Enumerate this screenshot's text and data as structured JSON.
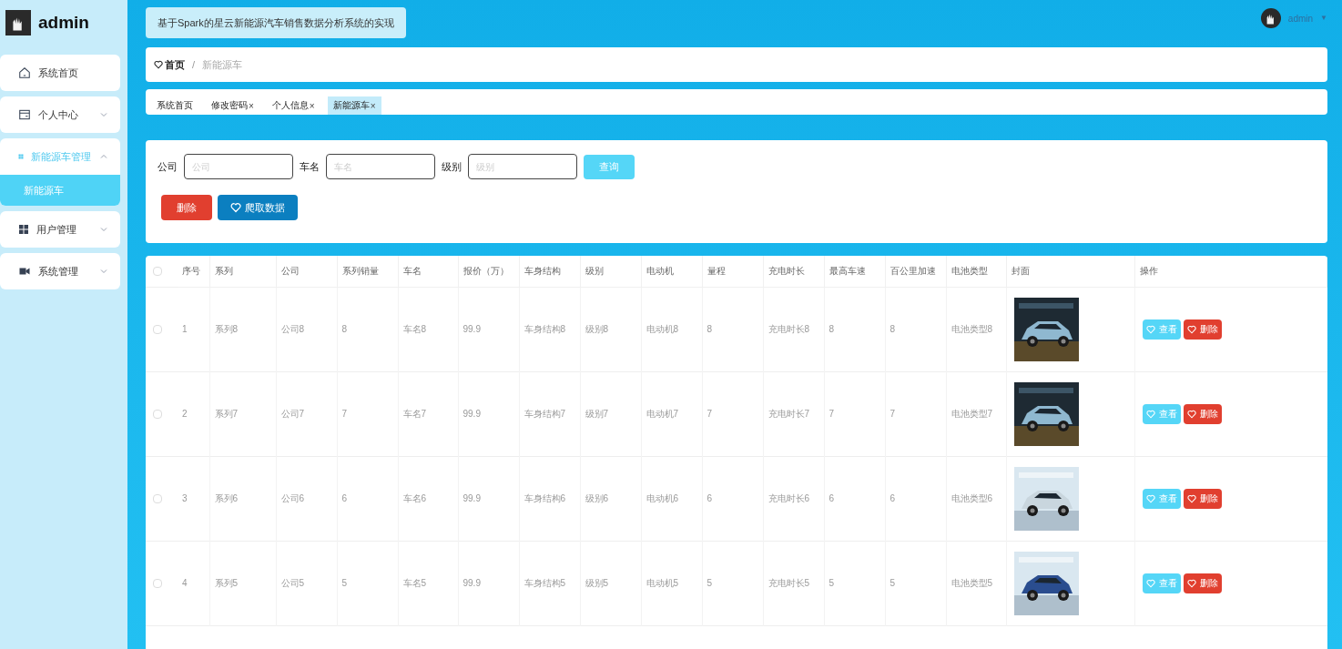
{
  "sidebar": {
    "user": "admin",
    "items": [
      {
        "label": "系统首页",
        "selected": false
      },
      {
        "label": "个人中心",
        "expanded": false,
        "selected": false
      },
      {
        "label": "新能源车管理",
        "expanded": true,
        "selected": true,
        "children": [
          {
            "label": "新能源车",
            "selected": true
          }
        ]
      },
      {
        "label": "用户管理",
        "expanded": false,
        "selected": false
      },
      {
        "label": "系统管理",
        "expanded": false,
        "selected": false
      }
    ]
  },
  "header": {
    "title": "基于Spark的星云新能源汽车销售数据分析系统的实现",
    "user": "admin",
    "caret": "▼"
  },
  "breadcrumb": {
    "items": [
      "首页",
      "新能源车"
    ],
    "separator": "/"
  },
  "tabs": [
    {
      "label": "系统首页",
      "selected": false
    },
    {
      "label": "修改密码",
      "close": "×",
      "selected": false
    },
    {
      "label": "个人信息",
      "close": "×",
      "selected": false
    },
    {
      "label": "新能源车",
      "close": "×",
      "selected": true
    }
  ],
  "search": {
    "fields": [
      {
        "label": "公司",
        "placeholder": "公司"
      },
      {
        "label": "车名",
        "placeholder": "车名"
      },
      {
        "label": "级别",
        "placeholder": "级别"
      }
    ],
    "query_button": "查询",
    "delete_button": "删除",
    "crawl_button": "爬取数据"
  },
  "table": {
    "all_checked": false,
    "columns": [
      "序号",
      "系列",
      "公司",
      "系列销量",
      "车名",
      "报价（万）",
      "车身结构",
      "级别",
      "电动机",
      "量程",
      "充电时长",
      "最高车速",
      "百公里加速",
      "电池类型",
      "封面",
      "操作"
    ],
    "rows": [
      {
        "checked": false,
        "cells": [
          "1",
          "系列8",
          "公司8",
          "8",
          "车名8",
          "99.9",
          "车身结构8",
          "级别8",
          "电动机8",
          "8",
          "充电时长8",
          "8",
          "8",
          "电池类型8"
        ],
        "cover": {
          "kind": "picture"
        },
        "actions": [
          "查看",
          "删除"
        ]
      },
      {
        "checked": false,
        "cells": [
          "2",
          "系列7",
          "公司7",
          "7",
          "车名7",
          "99.9",
          "车身结构7",
          "级别7",
          "电动机7",
          "7",
          "充电时长7",
          "7",
          "7",
          "电池类型7"
        ],
        "cover": {
          "kind": "picture"
        },
        "actions": [
          "查看",
          "删除"
        ]
      },
      {
        "checked": false,
        "cells": [
          "3",
          "系列6",
          "公司6",
          "6",
          "车名6",
          "99.9",
          "车身结构6",
          "级别6",
          "电动机6",
          "6",
          "充电时长6",
          "6",
          "6",
          "电池类型6"
        ],
        "cover": {
          "kind": "picture"
        },
        "actions": [
          "查看",
          "删除"
        ]
      },
      {
        "checked": false,
        "cells": [
          "4",
          "系列5",
          "公司5",
          "5",
          "车名5",
          "99.9",
          "车身结构5",
          "级别5",
          "电动机5",
          "5",
          "充电时长5",
          "5",
          "5",
          "电池类型5"
        ],
        "cover": {
          "kind": "picture"
        },
        "actions": [
          "查看",
          "删除"
        ]
      }
    ]
  }
}
